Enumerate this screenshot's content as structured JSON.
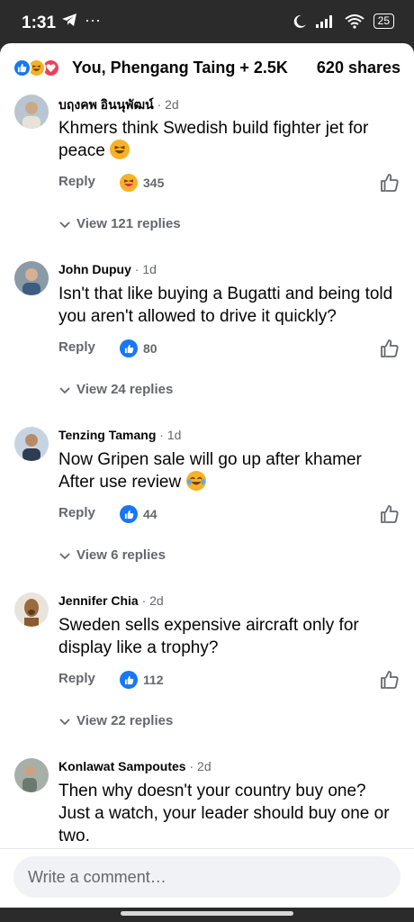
{
  "status_bar": {
    "time": "1:31",
    "left_icons": [
      "telegram-icon",
      "more-dots-icon"
    ],
    "right_icons": [
      "moon-icon",
      "signal-icon",
      "wifi-icon"
    ],
    "battery": "25"
  },
  "header": {
    "reaction_types": [
      "like",
      "haha",
      "love"
    ],
    "reactors": "You, Phengang Taing + 2.5K",
    "shares": "620 shares"
  },
  "comments": [
    {
      "author": "บฤงคพ อินนุพัฒน์",
      "time": "· 2d",
      "text": "Khmers think Swedish build fighter jet for peace",
      "emoji": "laughing-emoji",
      "reply_label": "Reply",
      "reaction_type": "haha",
      "reaction_count": "345",
      "view_replies": "View 121 replies"
    },
    {
      "author": "John Dupuy",
      "time": "· 1d",
      "text": "Isn't that like buying a Bugatti and being told you aren't allowed to drive it quickly?",
      "reply_label": "Reply",
      "reaction_type": "like",
      "reaction_count": "80",
      "view_replies": "View 24 replies"
    },
    {
      "author": "Tenzing Tamang",
      "time": "· 1d",
      "text": "Now Gripen sale will go up after khamer After use review",
      "emoji": "tears-of-joy-emoji",
      "reply_label": "Reply",
      "reaction_type": "like",
      "reaction_count": "44",
      "view_replies": "View 6 replies"
    },
    {
      "author": "Jennifer Chia",
      "time": "· 2d",
      "text": "Sweden sells expensive aircraft only for display like a trophy?",
      "reply_label": "Reply",
      "reaction_type": "like",
      "reaction_count": "112",
      "view_replies": "View 22 replies"
    },
    {
      "author": "Konlawat Sampoutes",
      "time": "· 2d",
      "text": "Then why doesn't your country buy one? Just a watch, your leader should buy one or two."
    }
  ],
  "composer": {
    "placeholder": "Write a comment…"
  },
  "colors": {
    "like_blue": "#1877f2",
    "haha_yellow": "#f7b125",
    "love_red": "#f33e58",
    "secondary_text": "#65676b"
  }
}
